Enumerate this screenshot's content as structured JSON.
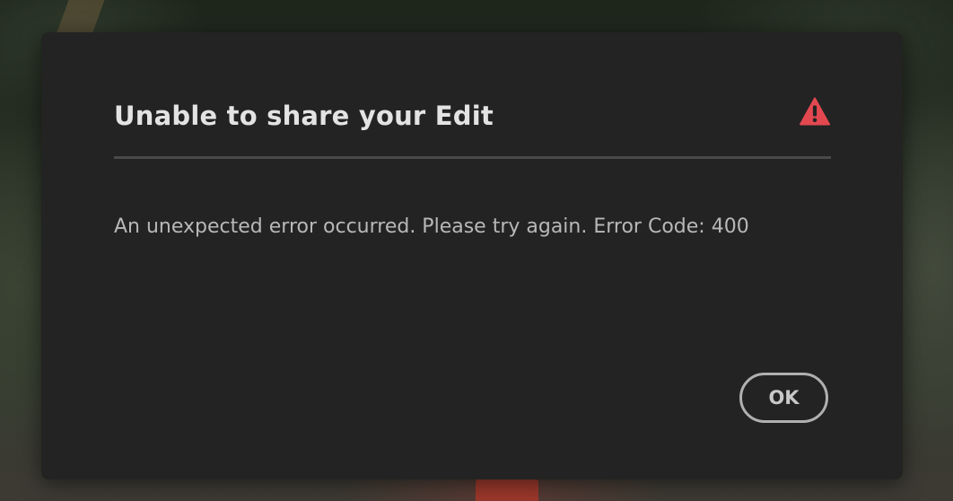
{
  "dialog": {
    "title": "Unable to share your Edit",
    "message": "An unexpected error occurred. Please try again. Error Code: 400",
    "ok_label": "OK",
    "alert_icon": "alert-triangle-icon",
    "colors": {
      "background": "#232323",
      "title": "#e3e3e3",
      "message": "#b8b8b8",
      "alert": "#e34850",
      "divider": "#4a4a4a"
    }
  }
}
